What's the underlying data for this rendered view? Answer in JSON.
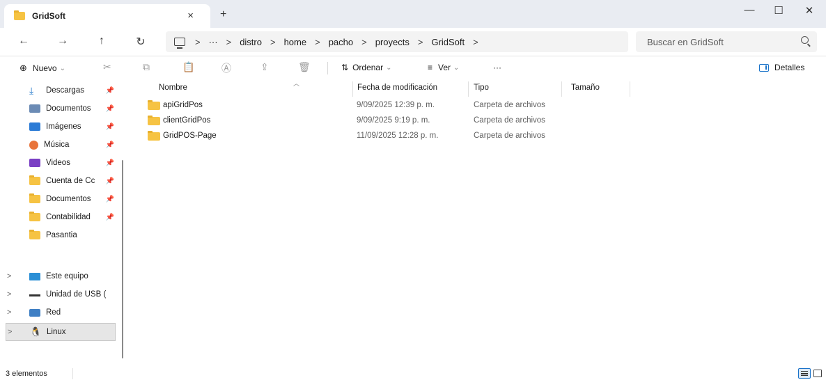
{
  "window": {
    "tab_title": "GridSoft",
    "tab_close": "×",
    "new_tab": "+",
    "minimize": "—",
    "maximize": "☐",
    "close": "✕"
  },
  "nav": {
    "back": "←",
    "forward": "→",
    "up": "↑",
    "refresh": "↻",
    "more": "···",
    "breadcrumbs": [
      "distro",
      "home",
      "pacho",
      "proyects",
      "GridSoft"
    ],
    "separator": ">",
    "search_placeholder": "Buscar en GridSoft"
  },
  "commands": {
    "new_label": "Nuevo",
    "sort_label": "Ordenar",
    "view_label": "Ver",
    "more_label": "···",
    "details_label": "Detalles"
  },
  "sidebar": {
    "items": [
      {
        "label": "Descargas",
        "icon": "download-icon"
      },
      {
        "label": "Documentos",
        "icon": "document-icon"
      },
      {
        "label": "Imágenes",
        "icon": "pictures-icon"
      },
      {
        "label": "Música",
        "icon": "music-icon"
      },
      {
        "label": "Videos",
        "icon": "videos-icon"
      },
      {
        "label": "Cuenta de Cc",
        "icon": "folder-icon"
      },
      {
        "label": "Documentos",
        "icon": "folder-icon"
      },
      {
        "label": "Contabilidad",
        "icon": "folder-icon"
      },
      {
        "label": "Pasantia",
        "icon": "folder-icon"
      }
    ],
    "drives": [
      {
        "label": "Este equipo",
        "icon": "computer-icon"
      },
      {
        "label": "Unidad de USB (",
        "icon": "usb-drive-icon"
      },
      {
        "label": "Red",
        "icon": "network-icon"
      },
      {
        "label": "Linux",
        "icon": "linux-icon"
      }
    ]
  },
  "columns": {
    "name": "Nombre",
    "date": "Fecha de modificación",
    "type": "Tipo",
    "size": "Tamaño"
  },
  "files": [
    {
      "name": "apiGridPos",
      "date": "9/09/2025 12:39 p. m.",
      "type": "Carpeta de archivos"
    },
    {
      "name": "clientGridPos",
      "date": "9/09/2025 9:19 p. m.",
      "type": "Carpeta de archivos"
    },
    {
      "name": "GridPOS-Page",
      "date": "11/09/2025 12:28 p. m.",
      "type": "Carpeta de archivos"
    }
  ],
  "status": {
    "item_count": "3 elementos"
  },
  "colors": {
    "accent": "#1a73c9",
    "folder": "#f6c343"
  }
}
